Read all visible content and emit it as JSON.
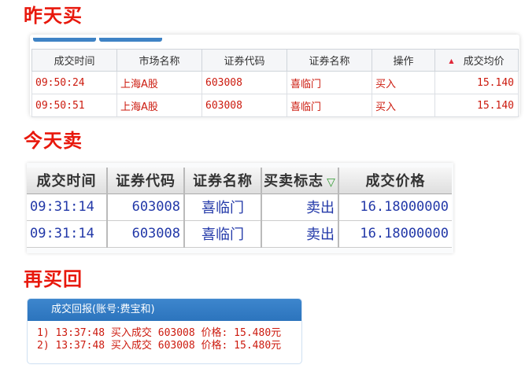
{
  "headings": {
    "yesterday_buy": "昨天买",
    "today_sell": "今天卖",
    "buy_back": "再买回"
  },
  "yesterday_table": {
    "columns": [
      "成交时间",
      "市场名称",
      "证券代码",
      "证券名称",
      "操作",
      "成交均价"
    ],
    "sort_icon": "triangle-up-icon",
    "rows": [
      [
        "09:50:24",
        "上海A股",
        "603008",
        "喜临门",
        "买入",
        "15.140"
      ],
      [
        "09:50:51",
        "上海A股",
        "603008",
        "喜临门",
        "买入",
        "15.140"
      ]
    ]
  },
  "today_table": {
    "columns": [
      "成交时间",
      "证券代码",
      "证券名称",
      "买卖标志",
      "成交价格"
    ],
    "sort_icon": "triangle-down-icon",
    "rows": [
      [
        "09:31:14",
        "603008",
        "喜临门",
        "卖出",
        "16.18000000"
      ],
      [
        "09:31:14",
        "603008",
        "喜临门",
        "卖出",
        "16.18000000"
      ]
    ]
  },
  "fill_report": {
    "title": "成交回报(账号:费宝和)",
    "lines": [
      "1) 13:37:48 买入成交 603008 价格: 15.480元",
      "2) 13:37:48 买入成交 603008 价格: 15.480元"
    ]
  },
  "colors": {
    "heading_red": "#e8180c",
    "data_red": "#cc1a0e",
    "data_blue": "#2238a8",
    "accent_blue": "#3f83c5"
  }
}
